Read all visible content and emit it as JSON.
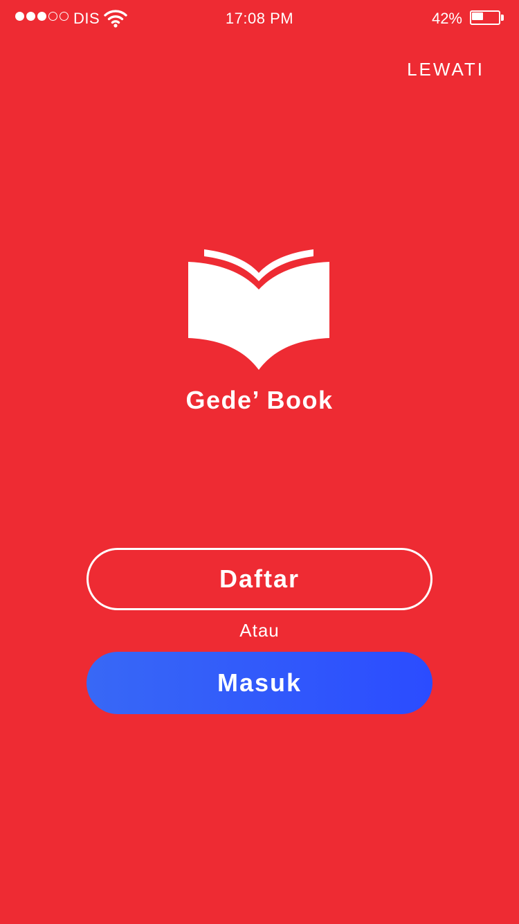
{
  "status_bar": {
    "signal_strength_filled": 3,
    "signal_strength_total": 5,
    "carrier": "DIS",
    "time": "17:08 PM",
    "battery_percent_label": "42%",
    "battery_level": 0.42
  },
  "header": {
    "skip_label": "LEWATI"
  },
  "brand": {
    "app_name": "Gede’ Book",
    "logo_icon": "open-book-icon"
  },
  "actions": {
    "register_label": "Daftar",
    "separator_label": "Atau",
    "login_label": "Masuk"
  },
  "colors": {
    "background": "#ee2b33",
    "login_gradient_start": "#3868f6",
    "login_gradient_end": "#2b4cff",
    "foreground": "#ffffff"
  }
}
